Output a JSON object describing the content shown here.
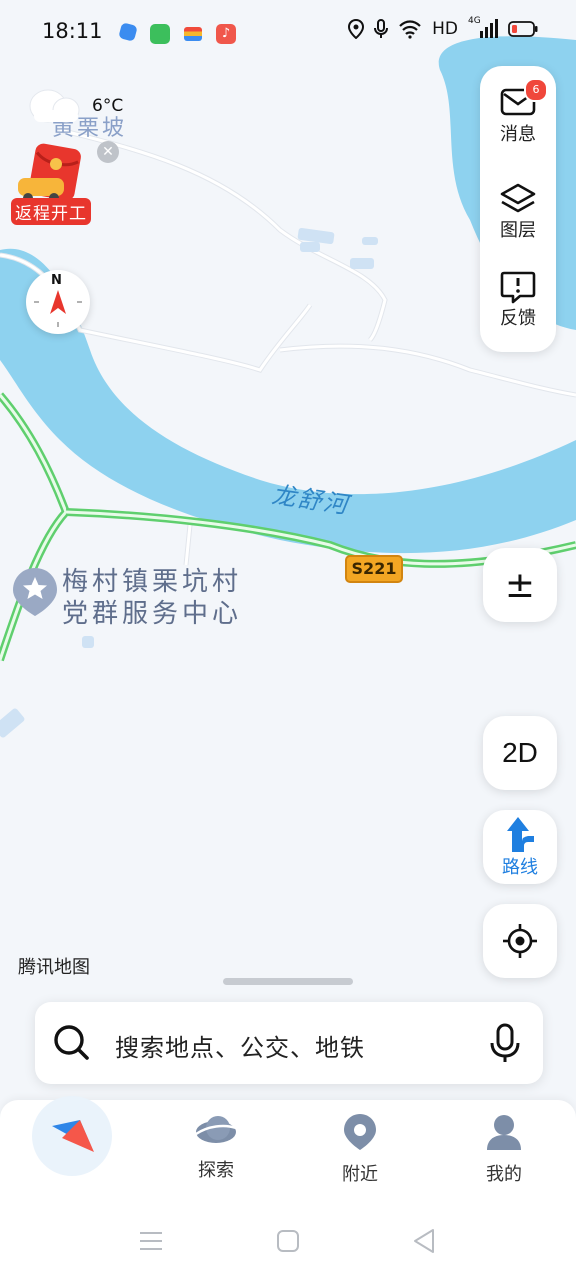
{
  "status_bar": {
    "time": "18:11",
    "network": "HD",
    "signal": "4G"
  },
  "weather": {
    "temperature": "6°C"
  },
  "promo": {
    "label": "返程开工"
  },
  "map": {
    "place_names": {
      "village_top": "黄栗坡",
      "river": "龙舒河",
      "road_code": "S221",
      "poi": "梅村镇栗坑村",
      "poi_line2": "党群服务中心"
    },
    "compass_letter": "N",
    "attribution": "腾讯地图"
  },
  "right_panel": {
    "messages_label": "消息",
    "messages_badge": "6",
    "layers_label": "图层",
    "feedback_label": "反馈"
  },
  "controls": {
    "zoom_label": "±",
    "view_mode": "2D",
    "route_label": "路线"
  },
  "search": {
    "placeholder": "搜索地点、公交、地铁"
  },
  "nav": {
    "items": [
      {
        "label": "探索"
      },
      {
        "label": "附近"
      },
      {
        "label": "我的"
      }
    ]
  },
  "colors": {
    "water": "#8ed2ef",
    "land": "#f3f6fa",
    "highway_green": "#5fcf6e",
    "road_badge": "#f3a623",
    "accent_blue": "#1f7fe0",
    "badge_red": "#f0473b"
  }
}
